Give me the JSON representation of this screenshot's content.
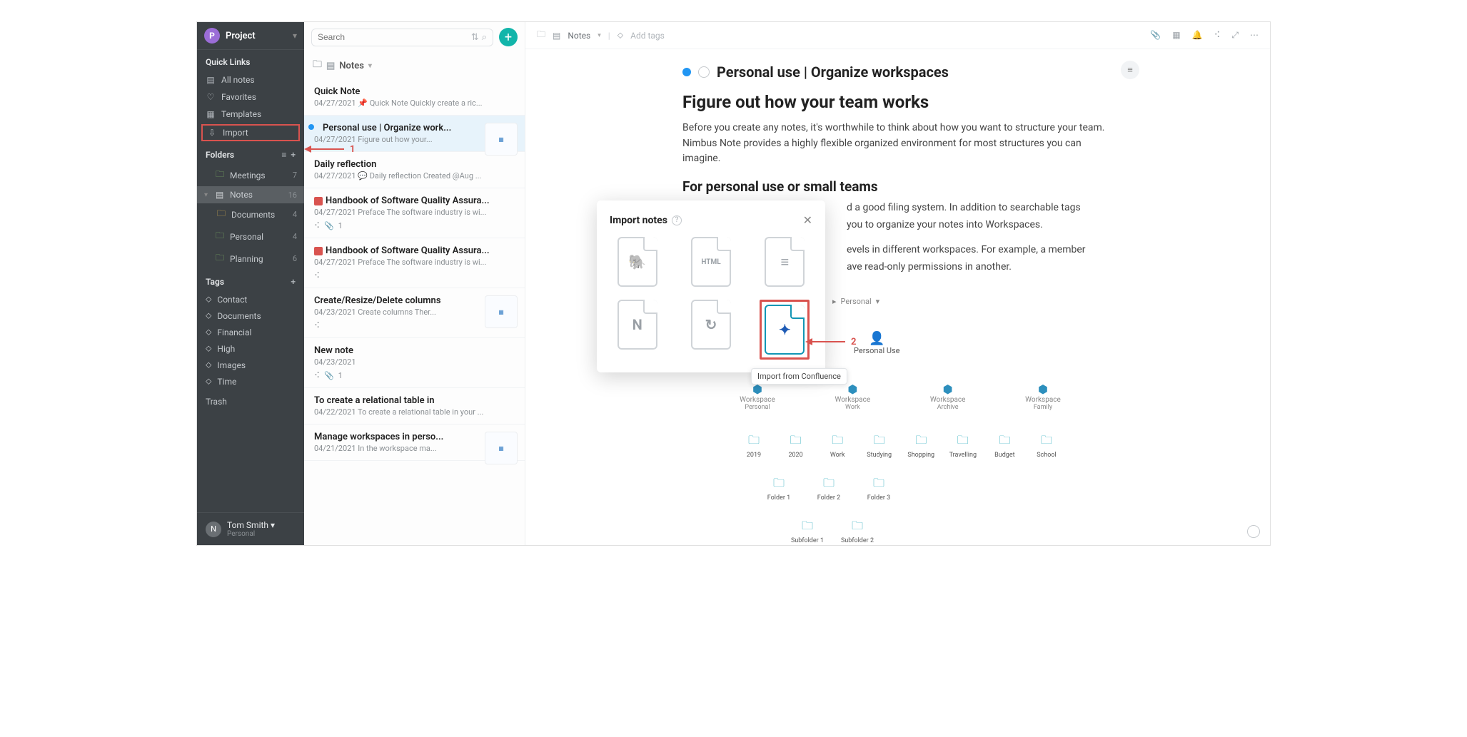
{
  "workspace": {
    "initial": "P",
    "name": "Project"
  },
  "quicklinks": {
    "title": "Quick Links",
    "items": [
      {
        "icon": "note-icon",
        "label": "All notes"
      },
      {
        "icon": "heart-icon",
        "label": "Favorites"
      },
      {
        "icon": "template-icon",
        "label": "Templates"
      },
      {
        "icon": "import-icon",
        "label": "Import"
      }
    ]
  },
  "annotations": {
    "one": "1",
    "two": "2"
  },
  "folders": {
    "title": "Folders",
    "items": [
      {
        "label": "Meetings",
        "count": "7"
      },
      {
        "label": "Notes",
        "count": "16",
        "selected": true,
        "children": [
          {
            "label": "Documents",
            "count": "4"
          }
        ]
      },
      {
        "label": "Personal",
        "count": "4"
      },
      {
        "label": "Planning",
        "count": "6"
      }
    ]
  },
  "tags": {
    "title": "Tags",
    "items": [
      "Contact",
      "Documents",
      "Financial",
      "High",
      "Images",
      "Time"
    ]
  },
  "trash": "Trash",
  "user": {
    "initial": "N",
    "name": "Tom Smith",
    "ws": "Personal"
  },
  "search": {
    "placeholder": "Search"
  },
  "mid": {
    "folder_label": "Notes",
    "items": [
      {
        "title": "Quick Note",
        "date": "04/27/2021",
        "preview": "📌 Quick Note Quickly create a ric..."
      },
      {
        "title": "Personal use | Organize work...",
        "date": "04/27/2021",
        "preview": "Figure out how your...",
        "selected": true,
        "thumb": true
      },
      {
        "title": "Daily reflection",
        "date": "04/27/2021",
        "preview": "💬 Daily reflection Created @Aug ..."
      },
      {
        "title": "Handbook of Software Quality Assura...",
        "date": "04/27/2021",
        "preview": "Preface The software industry is wi...",
        "reddot": true,
        "attach": "1"
      },
      {
        "title": "Handbook of Software Quality Assura...",
        "date": "04/27/2021",
        "preview": "Preface The software industry is wi...",
        "reddot": true
      },
      {
        "title": "Create/Resize/Delete columns",
        "date": "04/23/2021",
        "preview": "Create columns Ther...",
        "thumb": true
      },
      {
        "title": "New note",
        "date": "04/23/2021",
        "preview": "",
        "attach": "1"
      },
      {
        "title": "To create a relational table in",
        "date": "04/22/2021",
        "preview": "To create a relational table in your ..."
      },
      {
        "title": "Manage workspaces in perso...",
        "date": "04/21/2021",
        "preview": "In the workspace ma...",
        "thumb": true
      }
    ]
  },
  "main": {
    "crumb": "Notes",
    "addtags": "Add tags",
    "title": "Personal use | Organize workspaces",
    "h1": "Figure out how your team works",
    "p1": "Before you create any notes, it's worthwhile to think about how you want to structure your team. Nimbus Note provides a highly flexible organized environment for most structures you can imagine.",
    "h2": "For personal use or small teams",
    "p2a": "d a good filing system. In addition to searchable tags",
    "p2b": "you to organize your notes into Workspaces.",
    "p3a": "evels in different workspaces. For example, a member",
    "p3b": "ave read-only permissions in another.",
    "diagram": {
      "crumb": "Personal",
      "person": "Personal Use",
      "workspaces": [
        {
          "top": "Workspace",
          "sub": "Personal"
        },
        {
          "top": "Workspace",
          "sub": "Work"
        },
        {
          "top": "Workspace",
          "sub": "Archive"
        },
        {
          "top": "Workspace",
          "sub": "Family"
        }
      ],
      "folders1": [
        "2019",
        "2020",
        "Work",
        "Studying",
        "Shopping",
        "Travelling",
        "Budget",
        "School"
      ],
      "folders2": [
        "Folder 1",
        "Folder 2",
        "Folder 3"
      ],
      "folders3": [
        "Subfolder 1",
        "Subfolder 2"
      ]
    }
  },
  "modal": {
    "title": "Import notes",
    "items": [
      {
        "glyph_name": "evernote-icon",
        "glyph": "🐘"
      },
      {
        "glyph_name": "html-icon",
        "glyph": "HTML"
      },
      {
        "glyph_name": "text-icon",
        "glyph": "≡"
      },
      {
        "glyph_name": "notion-icon",
        "glyph": "N"
      },
      {
        "glyph_name": "circle-arrow-icon",
        "glyph": "↻"
      },
      {
        "glyph_name": "confluence-icon",
        "glyph": "✦",
        "selected": true,
        "highlighted": true
      }
    ],
    "tooltip": "Import from Confluence"
  }
}
